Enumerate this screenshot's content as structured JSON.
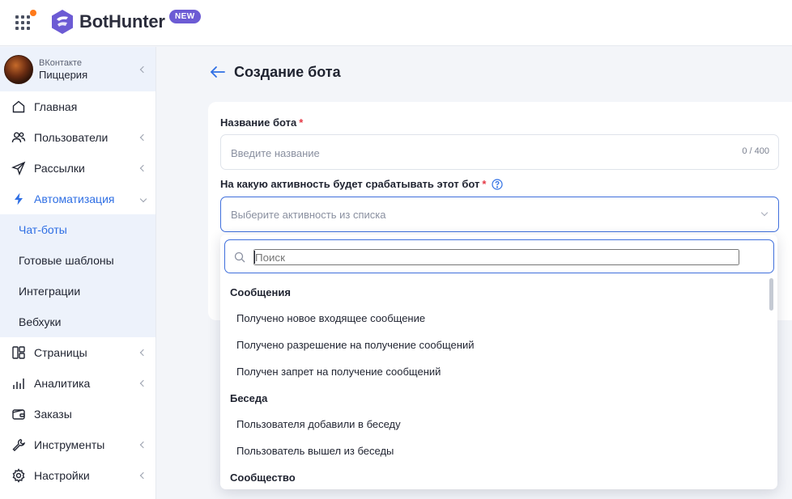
{
  "brand": {
    "name": "BotHunter",
    "badge": "NEW",
    "accent": "#6c5bd4",
    "notification_dot_color": "#ff7a1a"
  },
  "account": {
    "network": "ВКонтакте",
    "name": "Пиццерия"
  },
  "sidebar": {
    "items": [
      {
        "label": "Главная",
        "icon": "home-icon"
      },
      {
        "label": "Пользователи",
        "icon": "users-icon"
      },
      {
        "label": "Рассылки",
        "icon": "send-icon"
      },
      {
        "label": "Автоматизация",
        "icon": "lightning-icon"
      },
      {
        "label": "Страницы",
        "icon": "pages-icon"
      },
      {
        "label": "Аналитика",
        "icon": "analytics-icon"
      },
      {
        "label": "Заказы",
        "icon": "wallet-icon"
      },
      {
        "label": "Инструменты",
        "icon": "wrench-icon"
      },
      {
        "label": "Настройки",
        "icon": "gear-icon"
      }
    ],
    "automation_sub": [
      "Чат-боты",
      "Готовые шаблоны",
      "Интеграции",
      "Вебхуки"
    ]
  },
  "page": {
    "title": "Создание бота"
  },
  "form": {
    "name_label": "Название бота",
    "required_mark": "*",
    "name_placeholder": "Введите название",
    "name_counter": "0 / 400",
    "activity_label": "На какую активность будет срабатывать этот бот",
    "activity_placeholder": "Выберите активность из списка"
  },
  "dropdown": {
    "search_placeholder": "Поиск",
    "groups": [
      {
        "name": "Сообщения",
        "options": [
          "Получено новое входящее сообщение",
          "Получено разрешение на получение сообщений",
          "Получен запрет на получение сообщений"
        ]
      },
      {
        "name": "Беседа",
        "options": [
          "Пользователя добавили в беседу",
          "Пользователь вышел из беседы"
        ]
      },
      {
        "name": "Сообщество",
        "options": []
      }
    ]
  },
  "colors": {
    "active": "#2f6fe4",
    "required": "#e53946",
    "focus_border": "#3f6fdc"
  }
}
